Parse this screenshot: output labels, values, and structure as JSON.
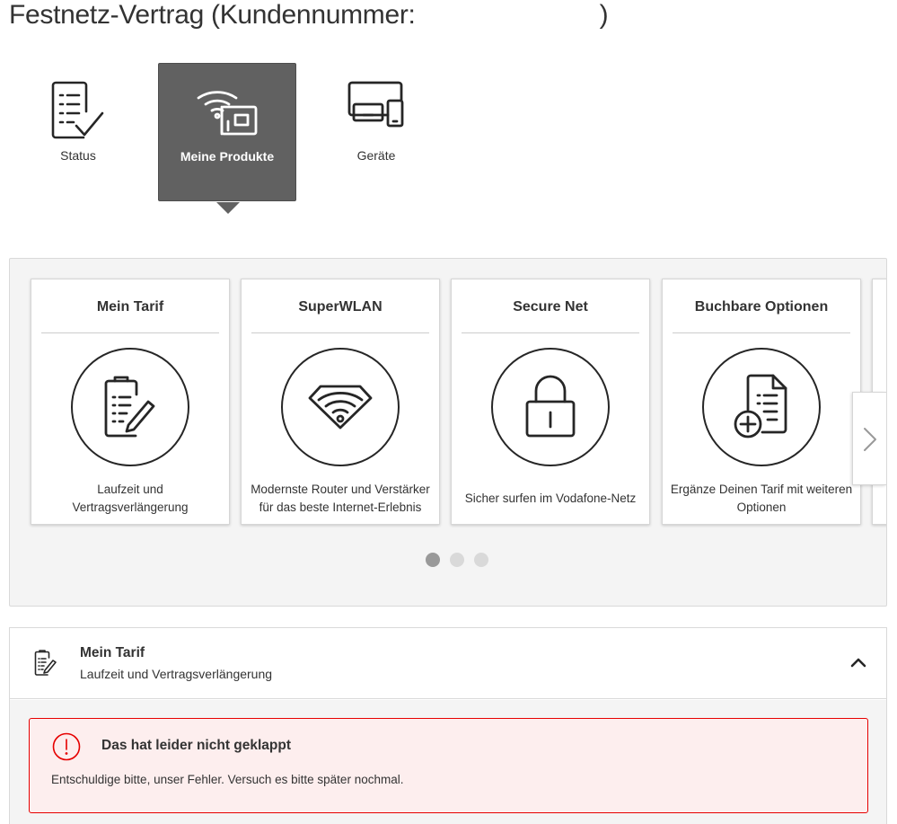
{
  "header": {
    "title_prefix": "Festnetz-Vertrag (Kundennummer:",
    "title_suffix": ")"
  },
  "nav": {
    "items": [
      {
        "label": "Status",
        "icon": "checklist-icon",
        "active": false
      },
      {
        "label": "Meine Produkte",
        "icon": "wifi-router-icon",
        "active": true
      },
      {
        "label": "Geräte",
        "icon": "devices-icon",
        "active": false
      }
    ]
  },
  "carousel": {
    "cards": [
      {
        "title": "Mein Tarif",
        "icon": "contract-pen-icon",
        "desc_line1": "Laufzeit und",
        "desc_line2": "Vertragsverlängerung"
      },
      {
        "title": "SuperWLAN",
        "icon": "wifi-diamond-icon",
        "desc_line1": "Modernste Router und Verstärker",
        "desc_line2": "für das beste Internet-Erlebnis"
      },
      {
        "title": "Secure Net",
        "icon": "padlock-icon",
        "desc_line1": "Sicher surfen im Vodafone-Netz"
      },
      {
        "title": "Buchbare Optionen",
        "icon": "document-plus-icon",
        "desc_line1": "Ergänze Deinen Tarif mit weiteren",
        "desc_line2": "Optionen"
      }
    ],
    "pages": 3,
    "active_page": 1
  },
  "accordion": {
    "title": "Mein Tarif",
    "subtitle": "Laufzeit und Vertragsverlängerung",
    "expanded": true
  },
  "error": {
    "title": "Das hat leider nicht geklappt",
    "message": "Entschuldige bitte, unser Fehler. Versuch es bitte später nochmal.",
    "color": "#e60000",
    "background": "#fdeeee"
  },
  "colors": {
    "active_tab": "#616161",
    "carousel_bg": "#f4f4f4",
    "dot_active": "#999999",
    "dot_inactive": "#d9d9d9"
  }
}
